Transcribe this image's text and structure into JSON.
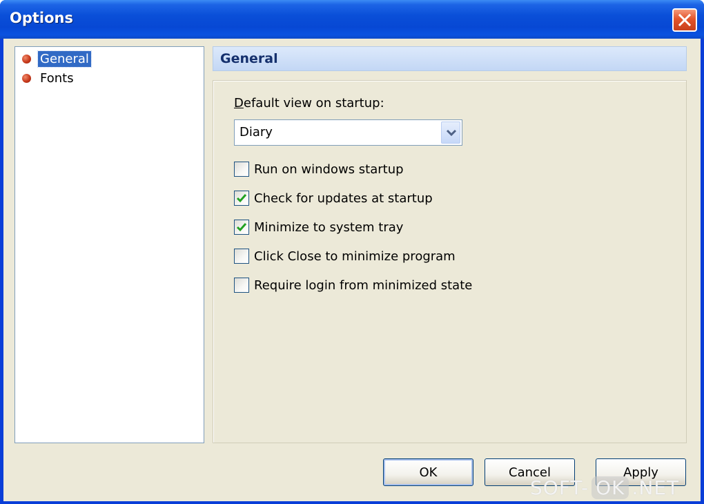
{
  "window": {
    "title": "Options"
  },
  "tree": {
    "items": [
      {
        "label": "General",
        "selected": true,
        "icon": "bullet-icon"
      },
      {
        "label": "Fonts",
        "selected": false,
        "icon": "bullet-icon"
      }
    ]
  },
  "section": {
    "title": "General"
  },
  "general": {
    "default_view_label_mnemonic": "D",
    "default_view_label_rest": "efault view on startup:",
    "default_view_value": "Diary",
    "options": [
      {
        "label": "Run on windows startup",
        "checked": false
      },
      {
        "label": "Check for updates at startup",
        "checked": true
      },
      {
        "label": "Minimize to system tray",
        "checked": true
      },
      {
        "label": "Click Close to minimize program",
        "checked": false
      },
      {
        "label": "Require login from minimized state",
        "checked": false
      }
    ]
  },
  "buttons": {
    "ok": "OK",
    "cancel": "Cancel",
    "apply": "Apply"
  },
  "watermark": {
    "part1": "SOFT-",
    "part2": "OK",
    "part3": ".NET"
  },
  "colors": {
    "title_bar": "#0a4fd8",
    "selection": "#316ac5",
    "checkmark": "#21a121",
    "bullet": "#c83a1c"
  }
}
